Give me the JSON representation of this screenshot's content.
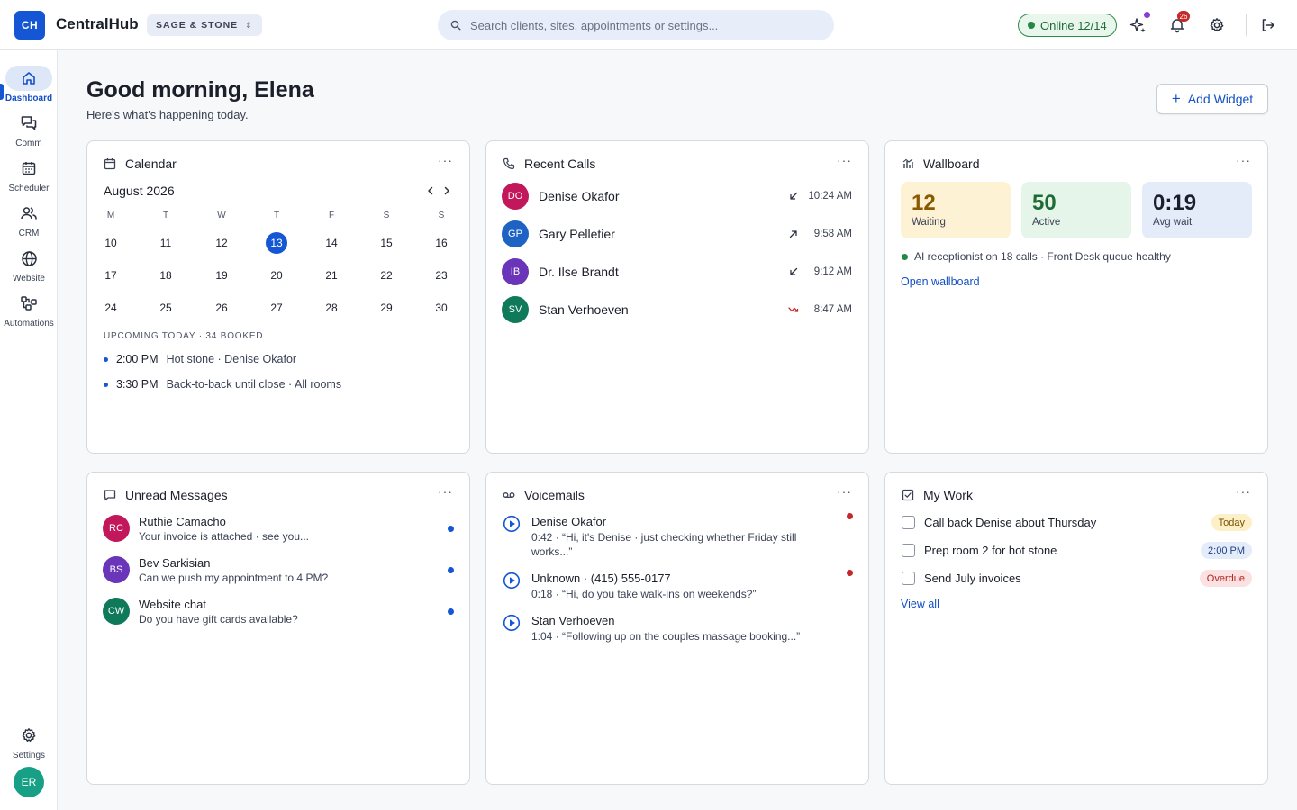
{
  "app": {
    "logo": "CH",
    "name": "CentralHub",
    "org": "SAGE & STONE"
  },
  "search": {
    "placeholder": "Search clients, sites, appointments or settings..."
  },
  "status": {
    "label": "Online 12/14"
  },
  "notifications": {
    "count": "26"
  },
  "sidebar": {
    "items": [
      {
        "label": "Dashboard",
        "icon": "home-icon"
      },
      {
        "label": "Comm",
        "icon": "chat-icon"
      },
      {
        "label": "Scheduler",
        "icon": "calendar-icon"
      },
      {
        "label": "CRM",
        "icon": "people-icon"
      },
      {
        "label": "Website",
        "icon": "globe-icon"
      },
      {
        "label": "Automations",
        "icon": "flow-icon"
      }
    ],
    "settings_label": "Settings",
    "user_initials": "ER"
  },
  "header": {
    "greeting": "Good morning, Elena",
    "subtitle": "Here's what's happening today.",
    "add_widget_label": "Add Widget"
  },
  "calendar": {
    "title": "Calendar",
    "month": "August 2026",
    "weekdays": [
      "M",
      "T",
      "W",
      "T",
      "F",
      "S",
      "S"
    ],
    "weeks": [
      [
        "10",
        "11",
        "12",
        "13",
        "14",
        "15",
        "16"
      ],
      [
        "17",
        "18",
        "19",
        "20",
        "21",
        "22",
        "23"
      ],
      [
        "24",
        "25",
        "26",
        "27",
        "28",
        "29",
        "30"
      ]
    ],
    "today": "13",
    "upcoming_label": "UPCOMING TODAY · 34 BOOKED",
    "appointments": [
      {
        "time": "2:00 PM",
        "desc": "Hot stone · Denise Okafor"
      },
      {
        "time": "3:30 PM",
        "desc": "Back-to-back until close · All rooms"
      }
    ]
  },
  "calls": {
    "title": "Recent Calls",
    "items": [
      {
        "initials": "DO",
        "name": "Denise Okafor",
        "direction": "incoming",
        "time": "10:24 AM",
        "color": "#c2185b"
      },
      {
        "initials": "GP",
        "name": "Gary Pelletier",
        "direction": "outgoing",
        "time": "9:58 AM",
        "color": "#1e63c4"
      },
      {
        "initials": "IB",
        "name": "Dr. Ilse Brandt",
        "direction": "incoming",
        "time": "9:12 AM",
        "color": "#6a35b8"
      },
      {
        "initials": "SV",
        "name": "Stan Verhoeven",
        "direction": "missed",
        "time": "8:47 AM",
        "color": "#0f7a5a"
      }
    ]
  },
  "wallboard": {
    "title": "Wallboard",
    "stats": [
      {
        "value": "12",
        "label": "Waiting",
        "bg": "#fdf2d4",
        "fg": "#8a5a00"
      },
      {
        "value": "50",
        "label": "Active",
        "bg": "#e5f5e9",
        "fg": "#1e6b35"
      },
      {
        "value": "0:19",
        "label": "Avg wait",
        "bg": "#e4ecfa",
        "fg": "#1b1f2a"
      }
    ],
    "note": "AI receptionist on 18 calls · Front Desk queue healthy",
    "link": "Open wallboard"
  },
  "messages": {
    "title": "Unread Messages",
    "items": [
      {
        "initials": "RC",
        "name": "Ruthie Camacho",
        "preview": "Your invoice is attached · see you...",
        "color": "#c2185b"
      },
      {
        "initials": "BS",
        "name": "Bev Sarkisian",
        "preview": "Can we push my appointment to 4 PM?",
        "color": "#6a35b8"
      },
      {
        "initials": "CW",
        "name": "Website chat",
        "preview": "Do you have gift cards available?",
        "color": "#0f7a5a"
      }
    ]
  },
  "voicemails": {
    "title": "Voicemails",
    "items": [
      {
        "title": "Denise Okafor",
        "preview": "0:42 · “Hi, it's Denise · just checking whether Friday still works...”",
        "new": true
      },
      {
        "title": "Unknown · (415) 555-0177",
        "preview": "0:18 · “Hi, do you take walk-ins on weekends?”",
        "new": true
      },
      {
        "title": "Stan Verhoeven",
        "preview": "1:04 · “Following up on the couples massage booking...”",
        "new": false
      }
    ]
  },
  "mywork": {
    "title": "My Work",
    "tasks": [
      {
        "label": "Call back Denise about Thursday",
        "badge": "Today",
        "bg": "#fdf0c8",
        "fg": "#7a5200"
      },
      {
        "label": "Prep room 2 for hot stone",
        "badge": "2:00 PM",
        "bg": "#e4ecfa",
        "fg": "#1b3f8a"
      },
      {
        "label": "Send July invoices",
        "badge": "Overdue",
        "bg": "#fbe1e1",
        "fg": "#b3261e"
      }
    ],
    "link": "View all"
  }
}
